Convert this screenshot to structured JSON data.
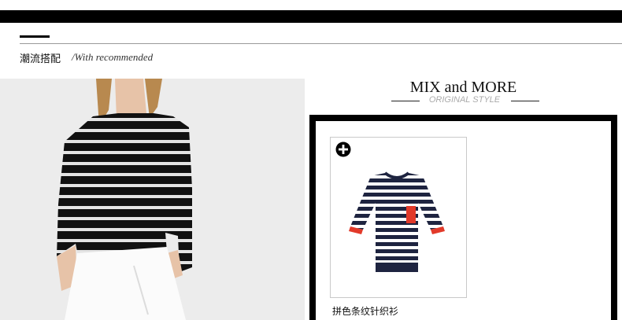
{
  "section": {
    "title": "潮流搭配",
    "subtitle": "/With recommended"
  },
  "mix": {
    "title": "MIX and MORE",
    "subtitle": "ORIGINAL STYLE"
  },
  "product": {
    "name": "拼色条纹针织衫",
    "add_icon": "plus-circle-icon"
  },
  "colors": {
    "bar": "#000000",
    "stripe_dark": "#111111",
    "stripe_light": "#e8e8e8",
    "navy": "#1e2440",
    "pocket_red": "#e23a2a"
  }
}
